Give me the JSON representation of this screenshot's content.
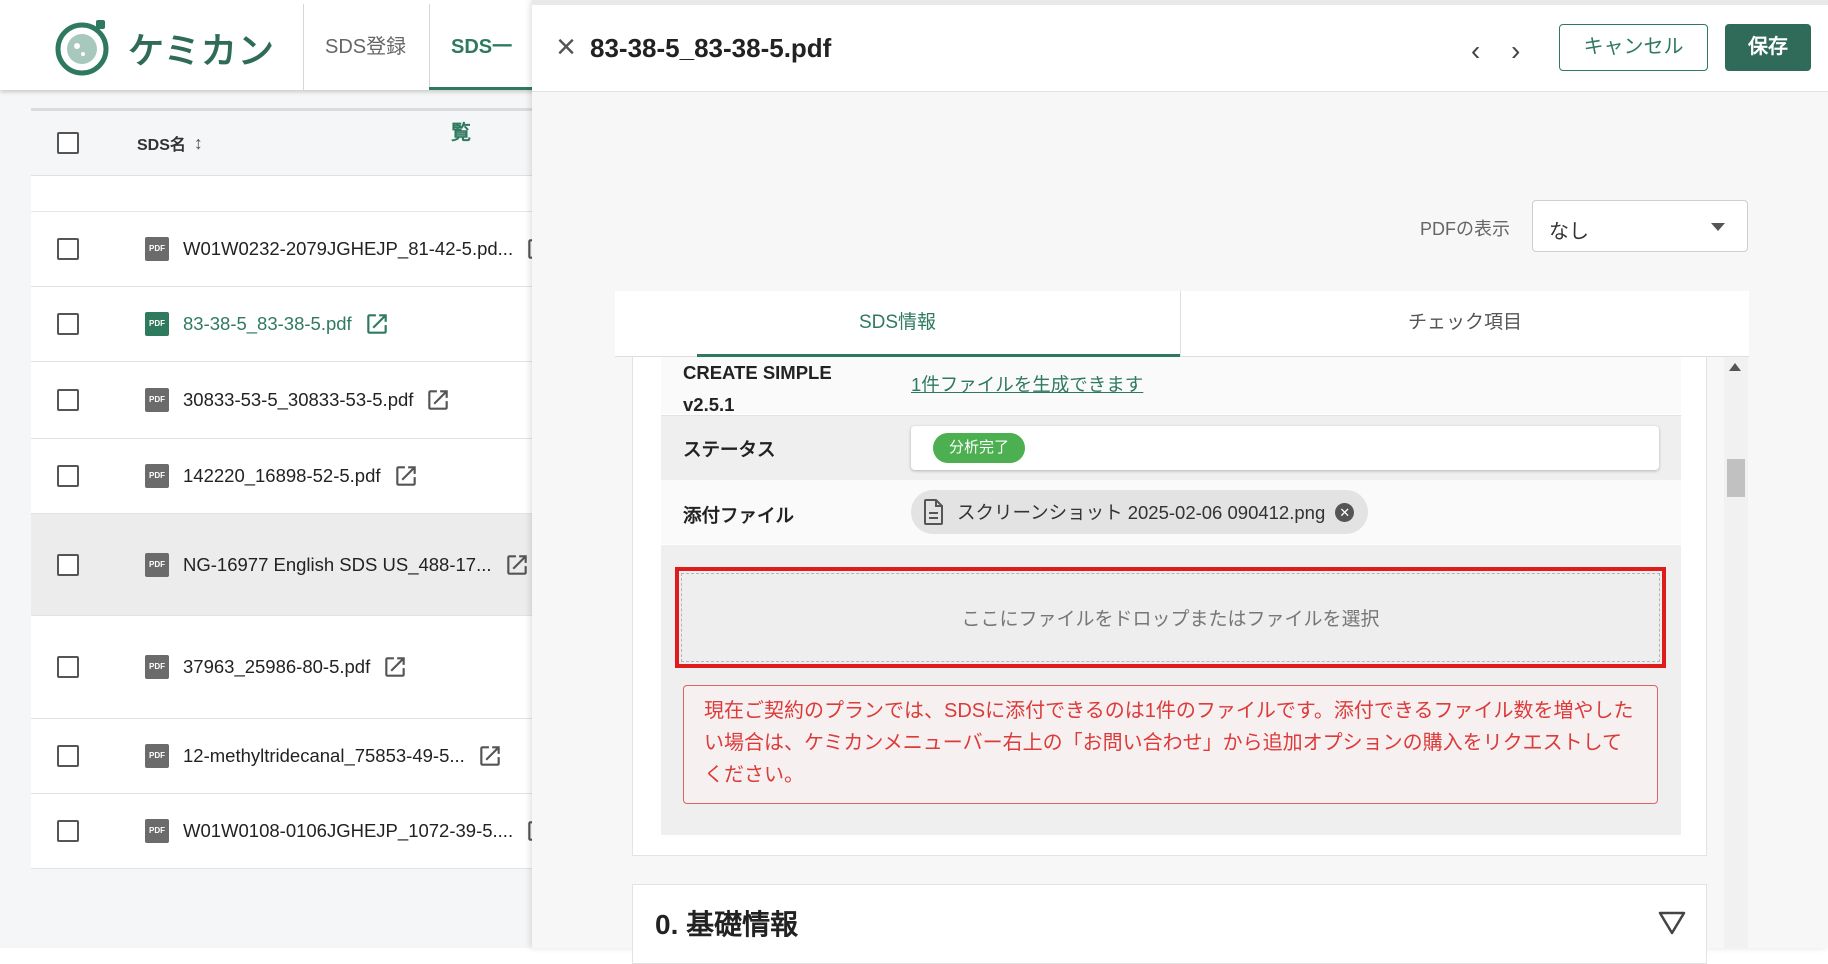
{
  "app": {
    "logo_text": "ケミカン",
    "nav": [
      "SDS登録",
      "SDS一覧"
    ]
  },
  "list": {
    "header_label": "SDS名",
    "rows": [
      {
        "name": "W01W0232-2079JGHEJP_81-42-5.pd...",
        "active": false
      },
      {
        "name": "83-38-5_83-38-5.pdf",
        "active": true
      },
      {
        "name": "30833-53-5_30833-53-5.pdf",
        "active": false
      },
      {
        "name": "142220_16898-52-5.pdf",
        "active": false
      },
      {
        "name": "NG-16977 English SDS US_488-17...",
        "active": false
      },
      {
        "name": "37963_25986-80-5.pdf",
        "active": false
      },
      {
        "name": "12-methyltridecanal_75853-49-5...",
        "active": false
      },
      {
        "name": "W01W0108-0106JGHEJP_1072-39-5....",
        "active": false
      }
    ],
    "pdf_icon_text": "PDF"
  },
  "drawer": {
    "title": "83-38-5_83-38-5.pdf",
    "cancel_label": "キャンセル",
    "save_label": "保存",
    "pdf_display_label": "PDFの表示",
    "pdf_display_value": "なし",
    "tabs": [
      "SDS情報",
      "チェック項目"
    ],
    "create_simple_label_1": "CREATE SIMPLE",
    "create_simple_label_2": "v2.5.1",
    "create_simple_link": "1件ファイルを生成できます",
    "status_label": "ステータス",
    "status_value": "分析完了",
    "attach_label": "添付ファイル",
    "attach_file": "スクリーンショット 2025-02-06 090412.png",
    "dropzone_text": "ここにファイルをドロップまたはファイルを選択",
    "notice_text": "現在ご契約のプランでは、SDSに添付できるのは1件のファイルです。添付できるファイル数を増やしたい場合は、ケミカンメニューバー右上の「お問い合わせ」から追加オプションの購入をリクエストしてください。",
    "section_title": "0. 基礎情報"
  },
  "colors": {
    "brand_green": "#2f7a5f",
    "save_bg": "#2f6b58",
    "status_green": "#4caf50",
    "error_red": "#dd3a3a",
    "highlight_red": "#e01b1b"
  }
}
